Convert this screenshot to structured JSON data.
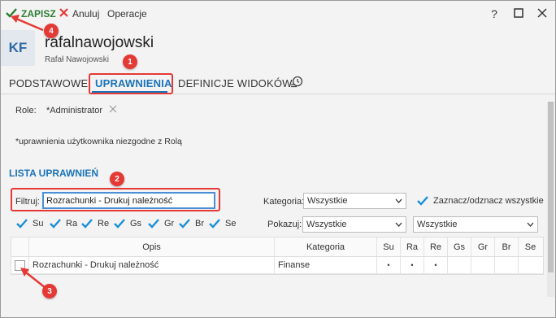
{
  "toolbar": {
    "save_label": "ZAPISZ",
    "cancel_label": "Anuluj",
    "operations_label": "Operacje"
  },
  "window_controls": {
    "help": "?",
    "maximize": "☐",
    "close": "✕"
  },
  "user": {
    "initials": "KF",
    "login": "rafalnawojowski",
    "full_name": "Rafał Nawojowski"
  },
  "tabs": {
    "basic": "PODSTAWOWE",
    "permissions": "UPRAWNIENIA",
    "view_definitions": "DEFINICJE WIDOKÓW"
  },
  "roles": {
    "label": "Role:",
    "value": "*Administrator"
  },
  "note": "*uprawnienia użytkownika niezgodne z Rolą",
  "section_title": "LISTA UPRAWNIEŃ",
  "filter": {
    "label": "Filtruj:",
    "value": "Rozrachunki - Drukuj należność"
  },
  "category": {
    "label": "Kategoria:",
    "value": "Wszystkie"
  },
  "select_all_label": "Zaznacz/odznacz wszystkie",
  "perm_checks": [
    "Su",
    "Ra",
    "Re",
    "Gs",
    "Gr",
    "Br",
    "Se"
  ],
  "show": {
    "label": "Pokazuj:",
    "value1": "Wszystkie",
    "value2": "Wszystkie"
  },
  "table": {
    "headers": [
      "Opis",
      "Kategoria",
      "Su",
      "Ra",
      "Re",
      "Gs",
      "Gr",
      "Br",
      "Se"
    ],
    "rows": [
      {
        "desc": "Rozrachunki - Drukuj należność",
        "category": "Finanse",
        "su": "•",
        "ra": "•",
        "re": "•",
        "gs": "",
        "gr": "",
        "br": "",
        "se": ""
      }
    ]
  },
  "badges": [
    "1",
    "2",
    "3",
    "4"
  ],
  "colors": {
    "accent": "#1a73b8",
    "annotation": "#e53935",
    "save": "#2e7d32"
  }
}
